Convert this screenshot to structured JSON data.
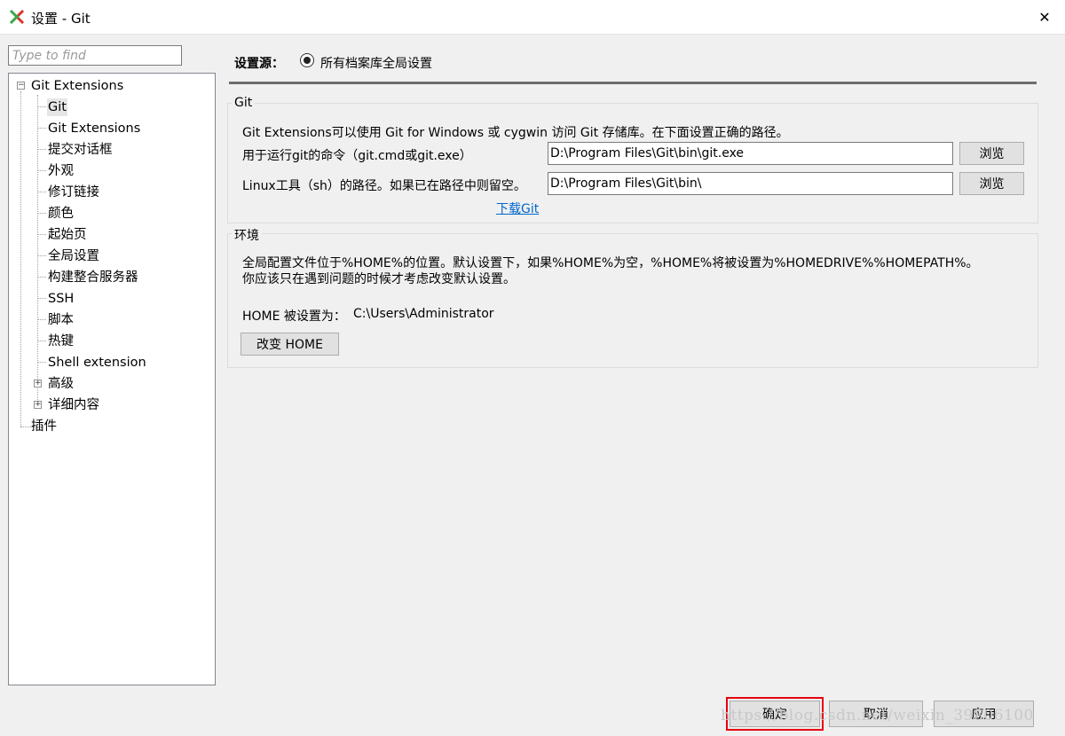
{
  "window": {
    "title": "设置 - Git",
    "close_glyph": "✕"
  },
  "sidebar": {
    "search_placeholder": "Type to find",
    "root_label": "Git Extensions",
    "items": [
      {
        "label": "Git"
      },
      {
        "label": "Git Extensions"
      },
      {
        "label": "提交对话框"
      },
      {
        "label": "外观"
      },
      {
        "label": "修订链接"
      },
      {
        "label": "颜色"
      },
      {
        "label": "起始页"
      },
      {
        "label": "全局设置"
      },
      {
        "label": "构建整合服务器"
      },
      {
        "label": "SSH"
      },
      {
        "label": "脚本"
      },
      {
        "label": "热键"
      },
      {
        "label": "Shell extension"
      },
      {
        "label": "高级"
      },
      {
        "label": "详细内容"
      }
    ],
    "plugins_label": "插件",
    "selected_index": 0
  },
  "settings_source": {
    "label": "设置源：",
    "option": "所有档案库全局设置"
  },
  "git_group": {
    "title": "Git",
    "description": "Git Extensions可以使用 Git for Windows 或 cygwin 访问 Git 存储库。在下面设置正确的路径。",
    "git_cmd_label": "用于运行git的命令（git.cmd或git.exe）",
    "git_cmd_value": "D:\\Program Files\\Git\\bin\\git.exe",
    "sh_label": "Linux工具（sh）的路径。如果已在路径中则留空。",
    "sh_value": "D:\\Program Files\\Git\\bin\\",
    "browse_label": "浏览",
    "download_link": "下载Git"
  },
  "env_group": {
    "title": "环境",
    "description_line1": "全局配置文件位于%HOME%的位置。默认设置下，如果%HOME%为空，%HOME%将被设置为%HOMEDRIVE%%HOMEPATH%。",
    "description_line2": "你应该只在遇到问题的时候才考虑改变默认设置。",
    "home_label": "HOME 被设置为：",
    "home_value": "C:\\Users\\Administrator",
    "change_home_button": "改变 HOME"
  },
  "footer": {
    "ok": "确定",
    "cancel": "取消",
    "apply": "应用",
    "watermark": "https://blog.csdn.net/weixin_39806100"
  },
  "colors": {
    "accent_highlight": "#e60012",
    "link": "#0066cc",
    "app_icon_green": "#3aa64a",
    "app_icon_red": "#d9342b"
  }
}
